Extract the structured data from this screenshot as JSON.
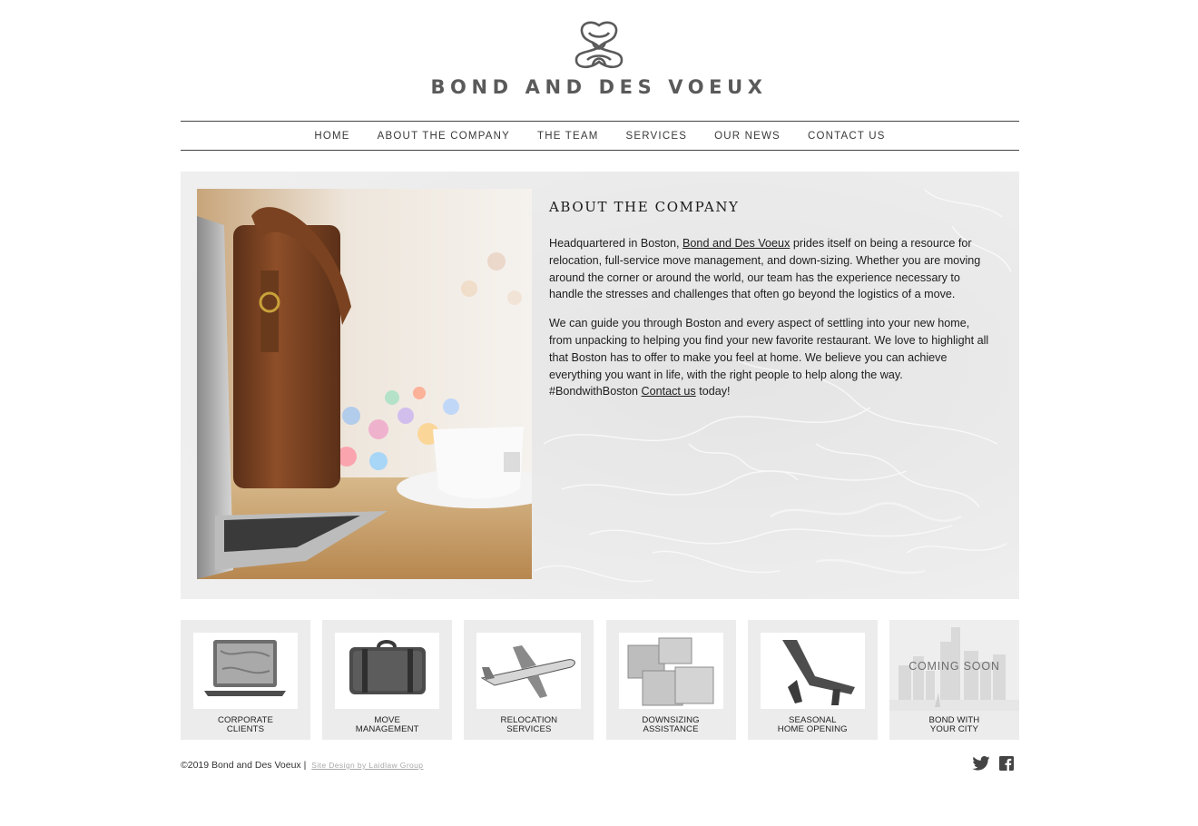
{
  "brand": {
    "name": "BOND AND DES VOEUX",
    "logo_icon": "knot-emblem-icon"
  },
  "nav": {
    "items": [
      {
        "label": "HOME"
      },
      {
        "label": "ABOUT THE COMPANY"
      },
      {
        "label": "THE TEAM"
      },
      {
        "label": "SERVICES"
      },
      {
        "label": "OUR NEWS"
      },
      {
        "label": "CONTACT US"
      }
    ]
  },
  "about": {
    "title": "ABOUT THE COMPANY",
    "p1_before": "Headquartered in Boston, ",
    "p1_link": "Bond and Des Voeux",
    "p1_after": " prides itself on being a resource for relocation, full-service move management, and down-sizing. Whether you are moving around the corner or around the world, our team has the experience necessary to handle the stresses and challenges that often go beyond the logistics of a move.",
    "p2_before": "We can guide you through Boston and every aspect of settling into your new home, from unpacking to helping you find your new favorite restaurant. We love to highlight all that Boston has to offer to make you feel at home. We believe you can achieve everything you want in life, with the right people to help along the way. #BondwithBoston ",
    "p2_link": "Contact us",
    "p2_after": " today!"
  },
  "services": [
    {
      "line1": "CORPORATE",
      "line2": "CLIENTS",
      "icon": "laptop-icon"
    },
    {
      "line1": "MOVE",
      "line2": "MANAGEMENT",
      "icon": "suitcase-icon"
    },
    {
      "line1": "RELOCATION",
      "line2": "SERVICES",
      "icon": "airplane-icon"
    },
    {
      "line1": "DOWNSIZING",
      "line2": "ASSISTANCE",
      "icon": "boxes-icon"
    },
    {
      "line1": "SEASONAL",
      "line2": "HOME OPENING",
      "icon": "lounge-chair-icon"
    },
    {
      "line1": "BOND WITH",
      "line2": "YOUR CITY",
      "icon": "city-skyline-icon",
      "overlay": "COMING SOON"
    }
  ],
  "footer": {
    "copyright": "©2019 Bond and Des Voeux |",
    "credit": "Site Design by Laidlaw Group",
    "social": [
      "twitter-icon",
      "facebook-icon"
    ]
  },
  "colors": {
    "panel": "#ececec",
    "text": "#222222",
    "accent_gray": "#5a5a5a"
  }
}
